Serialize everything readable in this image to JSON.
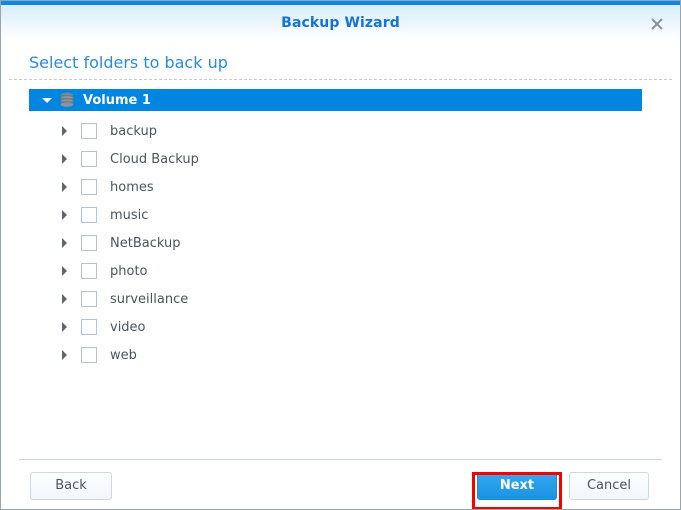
{
  "window": {
    "title": "Backup Wizard",
    "close_icon": "close-icon"
  },
  "content": {
    "step_heading": "Select folders to back up"
  },
  "tree": {
    "root": {
      "label": "Volume 1",
      "icon": "volume-disk-icon",
      "expanded": true,
      "checked": false
    },
    "children": [
      {
        "label": "backup",
        "expanded": false,
        "checked": false
      },
      {
        "label": "Cloud Backup",
        "expanded": false,
        "checked": false
      },
      {
        "label": "homes",
        "expanded": false,
        "checked": false
      },
      {
        "label": "music",
        "expanded": false,
        "checked": false
      },
      {
        "label": "NetBackup",
        "expanded": false,
        "checked": false
      },
      {
        "label": "photo",
        "expanded": false,
        "checked": false
      },
      {
        "label": "surveillance",
        "expanded": false,
        "checked": false
      },
      {
        "label": "video",
        "expanded": false,
        "checked": false
      },
      {
        "label": "web",
        "expanded": false,
        "checked": false
      }
    ]
  },
  "footer": {
    "back_label": "Back",
    "next_label": "Next",
    "cancel_label": "Cancel"
  },
  "colors": {
    "accent_blue": "#0086e0",
    "title_blue": "#1474d6",
    "heading_blue": "#2a8ae0",
    "primary_button": "#1b92e4",
    "highlight_red": "#f60000",
    "label_grey": "#4a5561"
  }
}
